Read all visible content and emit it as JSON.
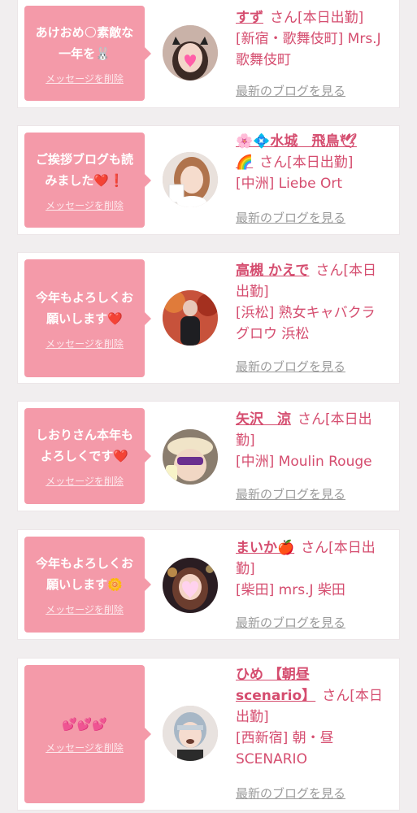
{
  "messages": [
    {
      "bubble_line1": "あけおめ🌕素敵な",
      "bubble_line2": "一年を🐰",
      "delete_label": "メッセージを削除",
      "name_line1": "すず",
      "suffix_line1": "さん[本日出勤]",
      "shop_line1": "[新宿・歌舞伎町] Mrs.J",
      "shop_line2": "歌舞伎町",
      "blog_label": "最新のブログを見る"
    },
    {
      "bubble_line1": "ご挨拶ブログも読",
      "bubble_line2": "みました❤️❗",
      "delete_label": "メッセージを削除",
      "name_line1": "🌸💠水城　飛鳥🕊",
      "name_line2": "🌈",
      "suffix_line2": "さん[本日出勤]",
      "shop_line1": "[中洲] Liebe Ort",
      "blog_label": "最新のブログを見る"
    },
    {
      "bubble_line1": "今年もよろしくお",
      "bubble_line2": "願いします❤️",
      "delete_label": "メッセージを削除",
      "name_line1": "高槻 かえで",
      "suffix_line1": "さん[本日",
      "suffix_line2": "出勤]",
      "shop_line1": "[浜松] 熟女キャバクラ",
      "shop_line2": "グロウ 浜松",
      "blog_label": "最新のブログを見る"
    },
    {
      "bubble_line1": "しおりさん本年も",
      "bubble_line2": "よろしくです❤️",
      "delete_label": "メッセージを削除",
      "name_line1": "矢沢　涼",
      "suffix_line1": "さん[本日出",
      "suffix_line2": "勤]",
      "shop_line1": "[中洲] Moulin Rouge",
      "blog_label": "最新のブログを見る"
    },
    {
      "bubble_line1": "今年もよろしくお",
      "bubble_line2": "願いします🌼",
      "delete_label": "メッセージを削除",
      "name_line1": "まいか🍎",
      "suffix_line1": "さん[本日出",
      "suffix_line2": "勤]",
      "shop_line1": "[柴田] mrs.J 柴田",
      "blog_label": "最新のブログを見る"
    },
    {
      "bubble_line1": "💕💕💕",
      "delete_label": "メッセージを削除",
      "name_line1": "ひめ 【朝昼",
      "name_line2": "scenario】",
      "suffix_line2": "さん[本日",
      "suffix_line3": "出勤]",
      "shop_line1": "[西新宿] 朝・昼",
      "shop_line2": "SCENARIO",
      "blog_label": "最新のブログを見る"
    }
  ],
  "colors": {
    "accent": "#d54d6f",
    "bubble": "#f49aa9",
    "background": "#f1eeef",
    "link_gray": "#9b9b9b"
  }
}
